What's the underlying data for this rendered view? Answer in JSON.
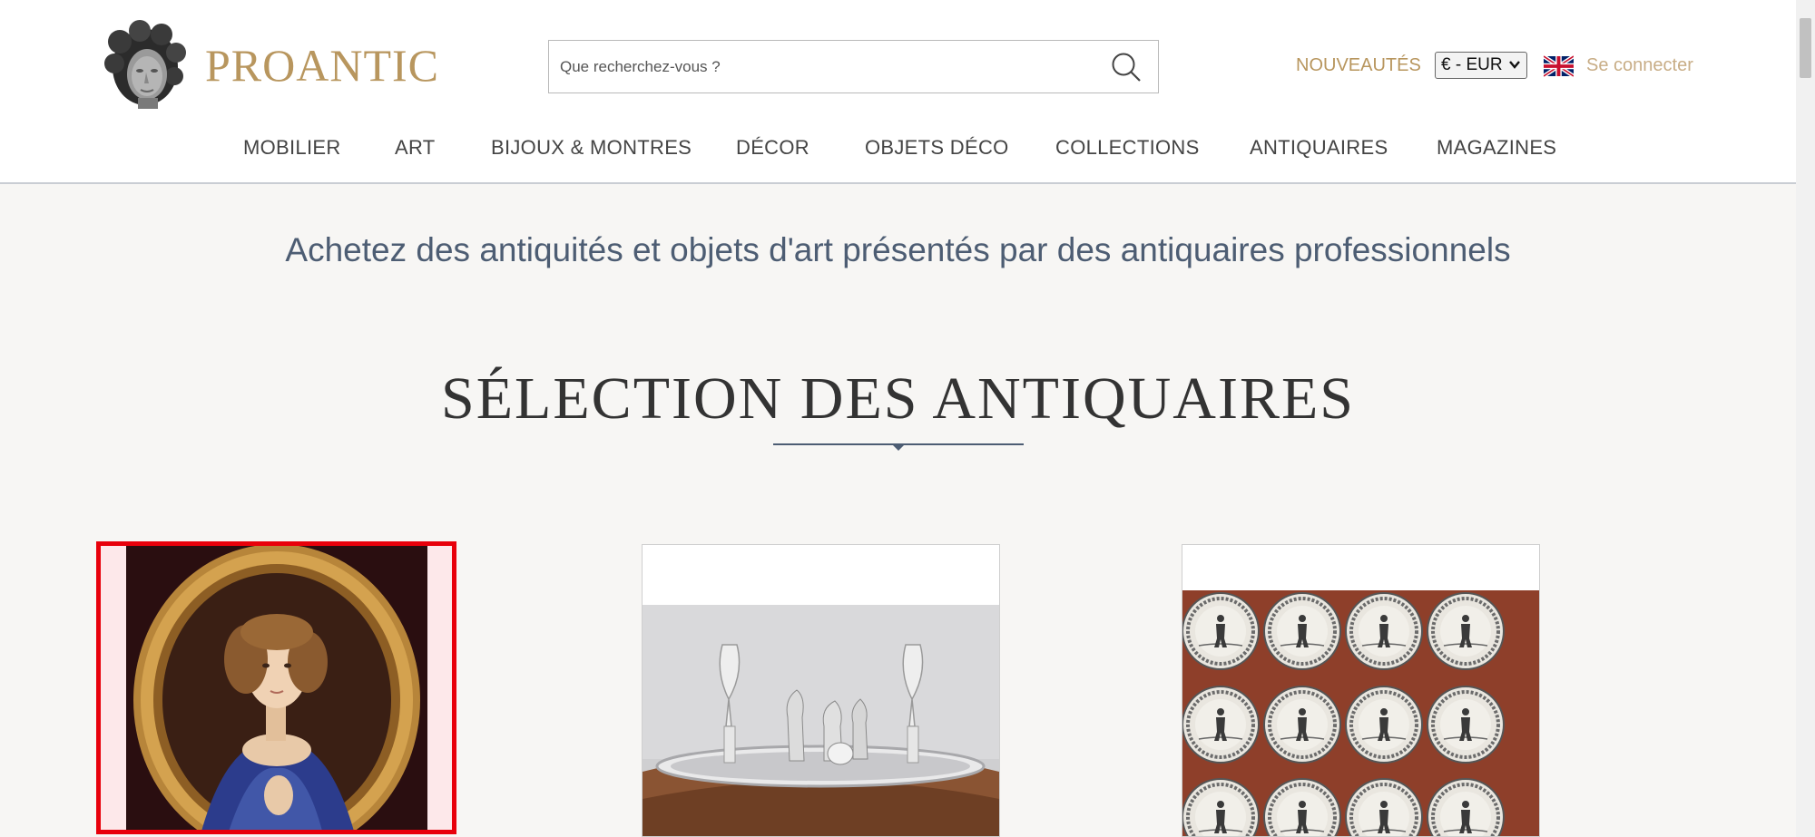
{
  "header": {
    "logo_text": "PROANTIC",
    "search_placeholder": "Que recherchez-vous ?",
    "nouveautes": "NOUVEAUTÉS",
    "currency": "€ - EUR",
    "login": "Se connecter"
  },
  "nav": [
    {
      "label": "MOBILIER"
    },
    {
      "label": "ART"
    },
    {
      "label": "BIJOUX & MONTRES"
    },
    {
      "label": "DÉCOR"
    },
    {
      "label": "OBJETS DÉCO"
    },
    {
      "label": "COLLECTIONS"
    },
    {
      "label": "ANTIQUAIRES"
    },
    {
      "label": "MAGAZINES"
    }
  ],
  "main": {
    "tagline": "Achetez des antiquités et objets d'art présentés par des antiquaires professionnels",
    "section_title": "SÉLECTION DES ANTIQUAIRES"
  },
  "icons": {
    "logo": "sculpted-head-logo",
    "search": "search-icon",
    "flag": "uk-flag-icon",
    "select": "chevron-down-icon"
  },
  "colors": {
    "brand_gold": "#b8965e",
    "tagline_slate": "#4d5d73",
    "selection_red": "#e8000b"
  }
}
